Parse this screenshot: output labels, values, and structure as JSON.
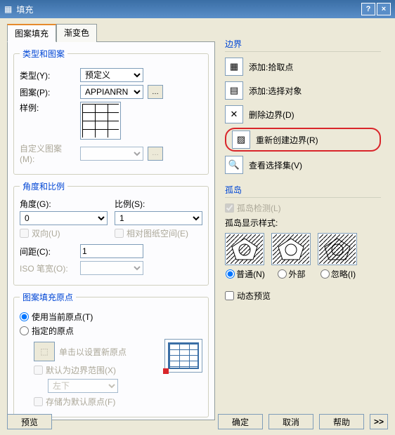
{
  "titlebar": {
    "title": "填充"
  },
  "tabs": {
    "hatch": "图案填充",
    "gradient": "渐变色"
  },
  "type_pattern": {
    "legend": "类型和图案",
    "type_label": "类型(Y):",
    "type_value": "预定义",
    "pattern_label": "图案(P):",
    "pattern_value": "APPIANRN",
    "sample_label": "样例:",
    "custom_label": "自定义图案(M):"
  },
  "angle_scale": {
    "legend": "角度和比例",
    "angle_label": "角度(G):",
    "angle_value": "0",
    "scale_label": "比例(S):",
    "scale_value": "1",
    "bidir": "双向(U)",
    "paperspace": "相对图纸空间(E)",
    "spacing_label": "间距(C):",
    "spacing_value": "1",
    "iso_label": "ISO 笔宽(O):"
  },
  "origin": {
    "legend": "图案填充原点",
    "use_current": "使用当前原点(T)",
    "specified": "指定的原点",
    "click_set": "单击以设置新原点",
    "default_extent": "默认为边界范围(X)",
    "position_value": "左下",
    "store_default": "存储为默认原点(F)"
  },
  "boundary": {
    "legend": "边界",
    "pick_points": "添加:拾取点",
    "select_obj": "添加:选择对象",
    "delete": "删除边界(D)",
    "recreate": "重新创建边界(R)",
    "view_sel": "查看选择集(V)"
  },
  "islands": {
    "legend": "孤岛",
    "detect": "孤岛检测(L)",
    "display_label": "孤岛显示样式:",
    "normal": "普通(N)",
    "outer": "外部",
    "ignore": "忽略(I)"
  },
  "dynamic_preview": "动态预览",
  "footer": {
    "preview": "预览",
    "ok": "确定",
    "cancel": "取消",
    "help": "帮助",
    "expand": ">>"
  }
}
